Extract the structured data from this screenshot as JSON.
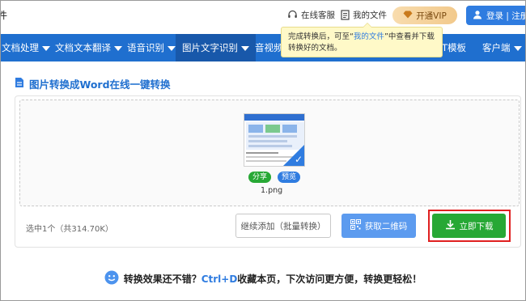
{
  "topbar": {
    "logo_fragment": "件",
    "service": "在线客服",
    "my_files": "我的文件",
    "vip": "开通VIP",
    "login": "登录 | 注册"
  },
  "nav": {
    "items": [
      {
        "label": "文档处理"
      },
      {
        "label": "文档文本翻译"
      },
      {
        "label": "语音识别"
      },
      {
        "label": "图片文字识别"
      },
      {
        "label": "音视频"
      },
      {
        "label": "T模板"
      },
      {
        "label": "客户端"
      }
    ]
  },
  "tooltip": {
    "part1": "完成转换后，可至“",
    "link": "我的文件",
    "part2": "”中查看并下载",
    "line2": "转换好的文档。"
  },
  "page": {
    "title": "图片转换成Word在线一键转换"
  },
  "file": {
    "name": "1.png",
    "share": "分享",
    "preview": "预览"
  },
  "actions": {
    "selected": "选中1个（共314.70K）",
    "add": "继续添加（批量转换）",
    "qr": "获取二维码",
    "download": "立即下载"
  },
  "footer": {
    "part1": "转换效果还不错？",
    "highlight": "Ctrl+D",
    "part2": "收藏本页，下次访问更方便，转换更轻松！"
  },
  "colors": {
    "nav": "#1f6fcf",
    "accent": "#2f7ce0",
    "download": "#27a835",
    "qr": "#5c9bef",
    "highlight_box": "#e02020"
  }
}
